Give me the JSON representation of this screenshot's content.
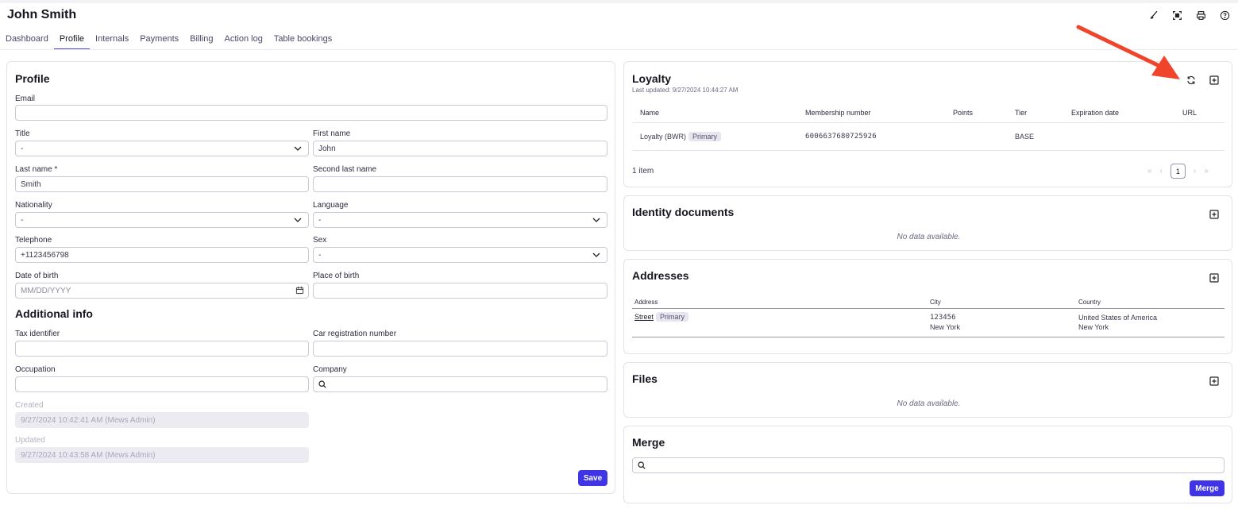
{
  "page": {
    "title": "John Smith"
  },
  "top_icons": [
    "brush-icon",
    "scan-icon",
    "printer-icon",
    "help-icon"
  ],
  "tabs": [
    {
      "label": "Dashboard",
      "active": false
    },
    {
      "label": "Profile",
      "active": true
    },
    {
      "label": "Internals",
      "active": false
    },
    {
      "label": "Payments",
      "active": false
    },
    {
      "label": "Billing",
      "active": false
    },
    {
      "label": "Action log",
      "active": false
    },
    {
      "label": "Table bookings",
      "active": false
    }
  ],
  "profile": {
    "title": "Profile",
    "email": {
      "label": "Email",
      "value": ""
    },
    "title_field": {
      "label": "Title",
      "value": "-"
    },
    "first_name": {
      "label": "First name",
      "value": "John"
    },
    "last_name": {
      "label": "Last name *",
      "value": "Smith"
    },
    "second_last_name": {
      "label": "Second last name",
      "value": ""
    },
    "nationality": {
      "label": "Nationality",
      "value": "-"
    },
    "language": {
      "label": "Language",
      "value": "-"
    },
    "telephone": {
      "label": "Telephone",
      "value": "+1123456798"
    },
    "sex": {
      "label": "Sex",
      "value": "-"
    },
    "date_of_birth": {
      "label": "Date of birth",
      "placeholder": "MM/DD/YYYY"
    },
    "place_of_birth": {
      "label": "Place of birth",
      "value": ""
    },
    "additional_title": "Additional info",
    "tax_identifier": {
      "label": "Tax identifier",
      "value": ""
    },
    "car_registration": {
      "label": "Car registration number",
      "value": ""
    },
    "occupation": {
      "label": "Occupation",
      "value": ""
    },
    "company": {
      "label": "Company",
      "value": ""
    },
    "created": {
      "label": "Created",
      "value": "9/27/2024 10:42:41 AM (Mews Admin)"
    },
    "updated": {
      "label": "Updated",
      "value": "9/27/2024 10:43:58 AM (Mews Admin)"
    },
    "save_label": "Save"
  },
  "loyalty": {
    "title": "Loyalty",
    "last_updated": "Last updated: 9/27/2024 10:44:27 AM",
    "columns": [
      "Name",
      "Membership number",
      "Points",
      "Tier",
      "Expiration date",
      "URL"
    ],
    "rows": [
      {
        "name": "Loyalty (BWR)",
        "badge": "Primary",
        "membership": "6006637680725926",
        "points": "",
        "tier": "BASE",
        "expiration": "",
        "url": ""
      }
    ],
    "count": "1 item",
    "pager": {
      "first": "«",
      "prev": "‹",
      "current": "1",
      "next": "›",
      "last": "»"
    }
  },
  "identity": {
    "title": "Identity documents",
    "empty": "No data available."
  },
  "addresses": {
    "title": "Addresses",
    "columns": [
      "Address",
      "City",
      "Country"
    ],
    "rows": [
      {
        "address": "Street",
        "badge": "Primary",
        "city_line1": "123456",
        "city_line2": "New York",
        "country_line1": "United States of America",
        "country_line2": "New York"
      }
    ]
  },
  "files": {
    "title": "Files",
    "empty": "No data available."
  },
  "merge": {
    "title": "Merge",
    "search_value": "",
    "button": "Merge"
  },
  "colors": {
    "accent": "#3f35e6",
    "annotation_arrow": "#f0452b"
  }
}
